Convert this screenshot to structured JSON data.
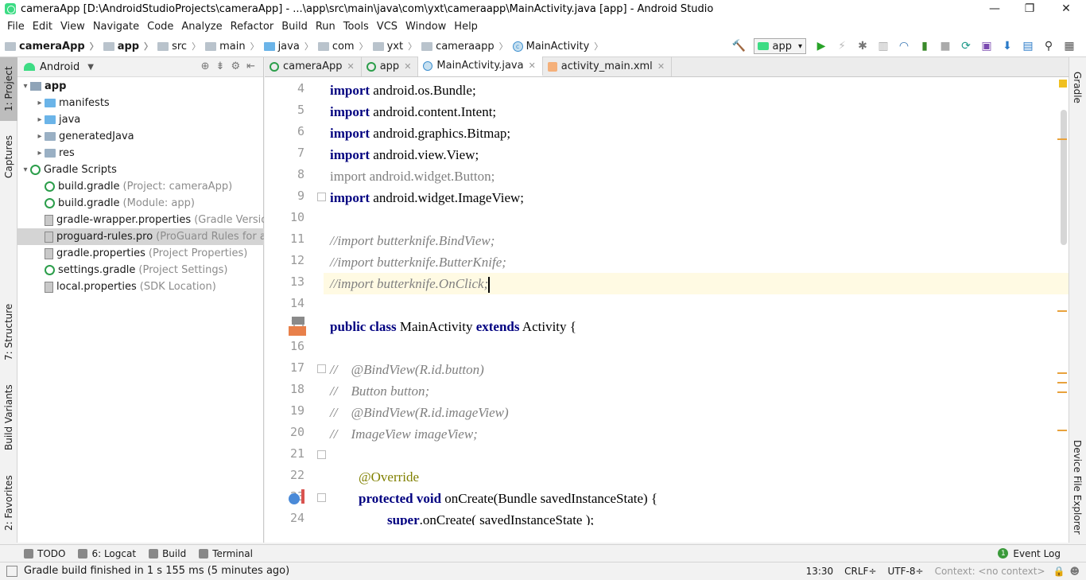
{
  "window": {
    "title": "cameraApp [D:\\AndroidStudioProjects\\cameraApp] - ...\\app\\src\\main\\java\\com\\yxt\\cameraapp\\MainActivity.java [app] - Android Studio",
    "minimize": "—",
    "restore": "❐",
    "close": "✕"
  },
  "menu": [
    "File",
    "Edit",
    "View",
    "Navigate",
    "Code",
    "Analyze",
    "Refactor",
    "Build",
    "Run",
    "Tools",
    "VCS",
    "Window",
    "Help"
  ],
  "breadcrumbs": [
    "cameraApp",
    "app",
    "src",
    "main",
    "java",
    "com",
    "yxt",
    "cameraapp",
    "MainActivity"
  ],
  "toolbar": {
    "run_config": "app",
    "icons": [
      "hammer-icon",
      "run-icon",
      "apply-changes-icon",
      "debug-icon",
      "profile-icon",
      "attach-debugger-icon",
      "stop-icon",
      "sync-icon",
      "avd-manager-icon",
      "sdk-manager-icon",
      "project-structure-icon",
      "search-everywhere-icon"
    ]
  },
  "left_tabs": {
    "project": "1: Project",
    "captures": "Captures",
    "structure": "7: Structure",
    "build_variants": "Build Variants",
    "favorites": "2: Favorites"
  },
  "right_tabs": {
    "gradle": "Gradle",
    "device_explorer": "Device File Explorer"
  },
  "project_panel": {
    "view_mode": "Android",
    "tree": [
      {
        "label": "app",
        "hint": "",
        "icon": "module-folder-icon",
        "level": 0,
        "arrow": "▾"
      },
      {
        "label": "manifests",
        "hint": "",
        "icon": "folder-icon",
        "level": 1,
        "arrow": "▸"
      },
      {
        "label": "java",
        "hint": "",
        "icon": "folder-icon",
        "level": 1,
        "arrow": "▸"
      },
      {
        "label": "generatedJava",
        "hint": "",
        "icon": "folder-icon",
        "level": 1,
        "arrow": "▸"
      },
      {
        "label": "res",
        "hint": "",
        "icon": "folder-icon",
        "level": 1,
        "arrow": "▸"
      },
      {
        "label": "Gradle Scripts",
        "hint": "",
        "icon": "gradle-icon",
        "level": 0,
        "arrow": "▾"
      },
      {
        "label": "build.gradle",
        "hint": "(Project: cameraApp)",
        "icon": "gradle-icon",
        "level": 1,
        "arrow": ""
      },
      {
        "label": "build.gradle",
        "hint": "(Module: app)",
        "icon": "gradle-icon",
        "level": 1,
        "arrow": ""
      },
      {
        "label": "gradle-wrapper.properties",
        "hint": "(Gradle Version",
        "icon": "file-icon",
        "level": 1,
        "arrow": ""
      },
      {
        "label": "proguard-rules.pro",
        "hint": "(ProGuard Rules for ap",
        "icon": "file-icon",
        "level": 1,
        "arrow": ""
      },
      {
        "label": "gradle.properties",
        "hint": "(Project Properties)",
        "icon": "file-icon",
        "level": 1,
        "arrow": ""
      },
      {
        "label": "settings.gradle",
        "hint": "(Project Settings)",
        "icon": "gradle-icon",
        "level": 1,
        "arrow": ""
      },
      {
        "label": "local.properties",
        "hint": "(SDK Location)",
        "icon": "file-icon",
        "level": 1,
        "arrow": ""
      }
    ]
  },
  "editor": {
    "tabs": [
      {
        "label": "cameraApp",
        "active": false
      },
      {
        "label": "app",
        "active": false
      },
      {
        "label": "MainActivity.java",
        "active": true
      },
      {
        "label": "activity_main.xml",
        "active": false
      }
    ],
    "line_numbers": [
      "4",
      "5",
      "6",
      "7",
      "8",
      "9",
      "10",
      "11",
      "12",
      "13",
      "14",
      "15",
      "16",
      "17",
      "18",
      "19",
      "20",
      "21",
      "22",
      "23",
      "24"
    ],
    "code": {
      "l4": [
        "import",
        " android.os.Bundle;"
      ],
      "l5": [
        "import",
        " android.content.Intent;"
      ],
      "l6": [
        "import",
        " android.graphics.Bitmap;"
      ],
      "l7": [
        "import",
        " android.view.View;"
      ],
      "l8": [
        "import",
        " android.widget.Button;"
      ],
      "l9": [
        "import",
        " android.widget.ImageView;"
      ],
      "l11": "//import butterknife.BindView;",
      "l12": "//import butterknife.ButterKnife;",
      "l13": "//import butterknife.OnClick;",
      "l15": [
        "public",
        " ",
        "class",
        " MainActivity ",
        "extends",
        " Activity {"
      ],
      "l17": "//    @BindView(R.id.button)",
      "l18": "//    Button button;",
      "l19": "//    @BindView(R.id.imageView)",
      "l20": "//    ImageView imageView;",
      "l22": "@Override",
      "l23": [
        "protected",
        " ",
        "void",
        " onCreate(Bundle savedInstanceState) {"
      ],
      "l24": [
        "super",
        ".onCreate( savedInstanceState );"
      ]
    }
  },
  "bottom_tabs": [
    "TODO",
    "6: Logcat",
    "Build",
    "Terminal"
  ],
  "event_log": "Event Log",
  "event_count": "1",
  "status": {
    "message": "Gradle build finished in 1 s 155 ms (5 minutes ago)",
    "position": "13:30",
    "line_sep": "CRLF÷",
    "encoding": "UTF-8÷",
    "context": "Context: <no context>"
  },
  "colors": {
    "keyword": "#000080",
    "comment": "#808080",
    "annotation": "#808000",
    "caret_line": "#fffae3"
  }
}
